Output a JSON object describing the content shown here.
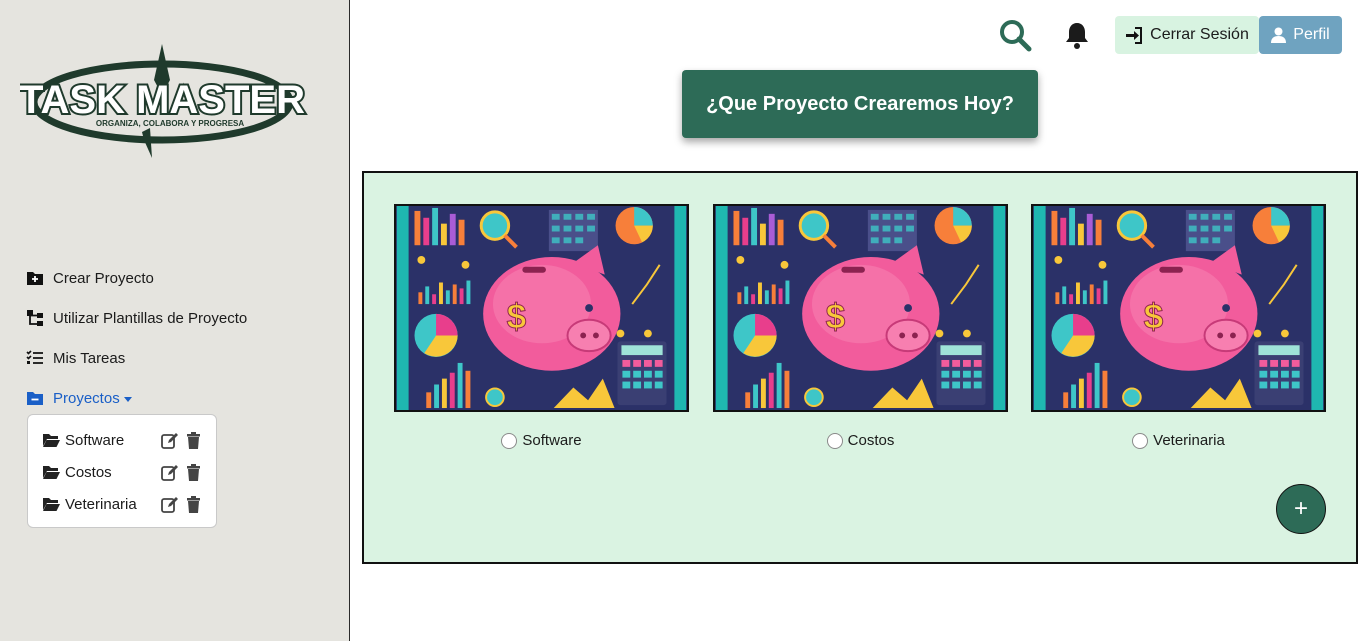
{
  "brand": {
    "logo_title": "TASK MASTER",
    "logo_tagline": "ORGANIZA, COLABORA Y PROGRESA"
  },
  "sidebar": {
    "items": [
      {
        "label": "Crear Proyecto",
        "icon": "folder-plus-icon"
      },
      {
        "label": "Utilizar Plantillas de Proyecto",
        "icon": "diagram-tree-icon"
      },
      {
        "label": "Mis Tareas",
        "icon": "list-check-icon"
      },
      {
        "label": "Proyectos",
        "icon": "folder-minus-icon",
        "active": true
      }
    ],
    "projects": [
      {
        "name": "Software"
      },
      {
        "name": "Costos"
      },
      {
        "name": "Veterinaria"
      }
    ]
  },
  "header": {
    "logout_label": "Cerrar Sesión",
    "profile_label": "Perfil"
  },
  "main": {
    "headline": "¿Que Proyecto Crearemos Hoy?",
    "cards": [
      {
        "label": "Software"
      },
      {
        "label": "Costos"
      },
      {
        "label": "Veterinaria"
      }
    ],
    "add_button": "+"
  },
  "colors": {
    "accent": "#2d6b57",
    "panel_bg": "#daf3e2",
    "sidebar_bg": "#e5e4df",
    "profile": "#6fa3c0",
    "active_link": "#1a5fc7"
  }
}
